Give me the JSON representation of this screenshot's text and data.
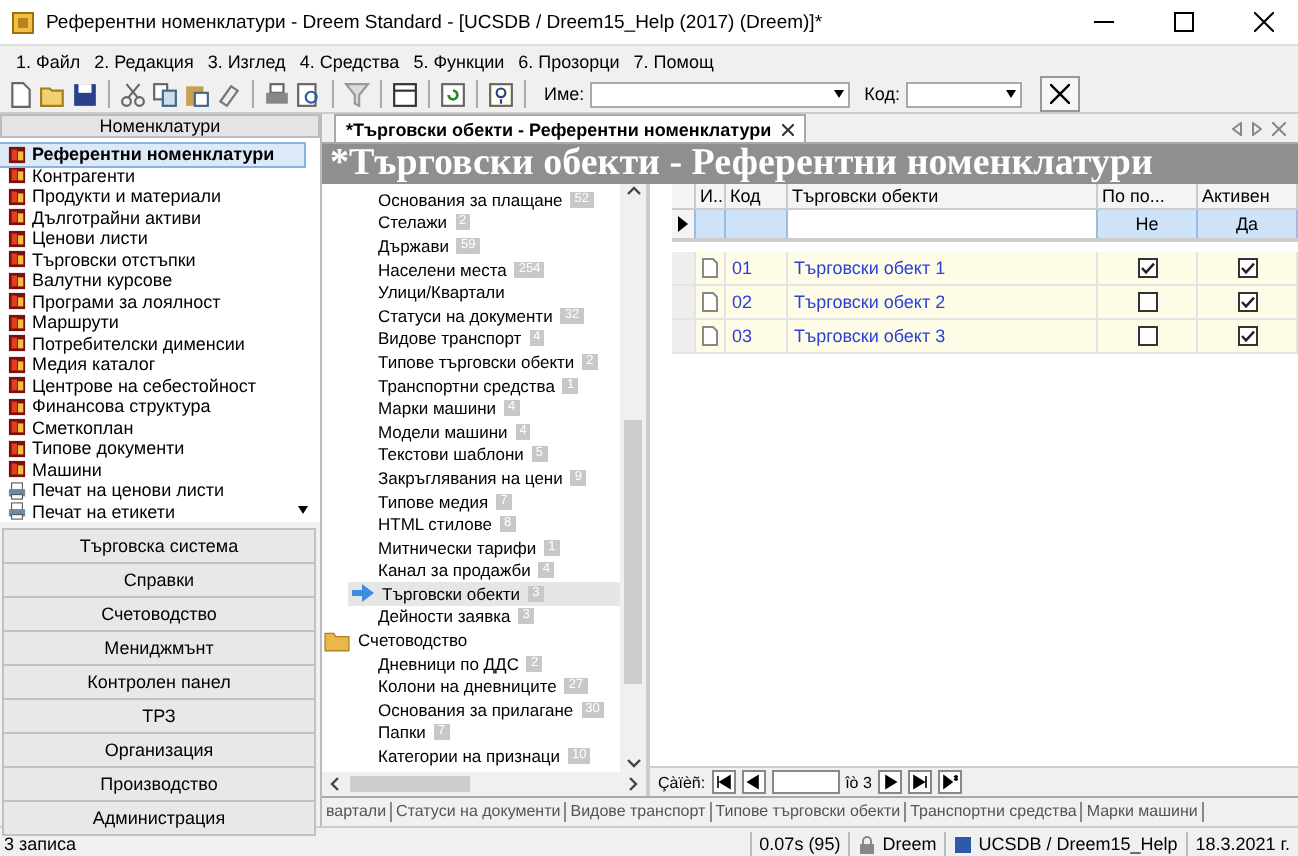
{
  "window": {
    "title": "Референтни номенклатури - Dreem Standard - [UCSDB / Dreem15_Help (2017) (Dreem)]*"
  },
  "menu": [
    "1. Файл",
    "2. Редакция",
    "3. Изглед",
    "4. Средства",
    "5. Функции",
    "6. Прозорци",
    "7. Помощ"
  ],
  "toolbar": {
    "name_label": "Име:",
    "code_label": "Код:"
  },
  "sidebar": {
    "header": "Номенклатури",
    "items": [
      {
        "label": "Референтни номенклатури",
        "kind": "module",
        "selected": true
      },
      {
        "label": "Контрагенти",
        "kind": "module",
        "selected": false
      },
      {
        "label": "Продукти и материали",
        "kind": "module",
        "selected": false
      },
      {
        "label": "Дълготрайни активи",
        "kind": "module",
        "selected": false
      },
      {
        "label": "Ценови листи",
        "kind": "module",
        "selected": false
      },
      {
        "label": "Търговски отстъпки",
        "kind": "module",
        "selected": false
      },
      {
        "label": "Валутни курсове",
        "kind": "module",
        "selected": false
      },
      {
        "label": "Програми за лоялност",
        "kind": "module",
        "selected": false
      },
      {
        "label": "Маршрути",
        "kind": "module",
        "selected": false
      },
      {
        "label": "Потребителски дименсии",
        "kind": "module",
        "selected": false
      },
      {
        "label": "Медия каталог",
        "kind": "module",
        "selected": false
      },
      {
        "label": "Центрове на себестойност",
        "kind": "module",
        "selected": false
      },
      {
        "label": "Финансова структура",
        "kind": "module",
        "selected": false
      },
      {
        "label": "Сметкоплан",
        "kind": "module",
        "selected": false
      },
      {
        "label": "Типове документи",
        "kind": "module",
        "selected": false
      },
      {
        "label": "Машини",
        "kind": "module",
        "selected": false
      },
      {
        "label": "Печат на ценови листи",
        "kind": "print",
        "selected": false
      },
      {
        "label": "Печат на етикети",
        "kind": "print",
        "selected": false
      }
    ],
    "groups": [
      "Търговска система",
      "Справки",
      "Счетоводство",
      "Мениджмънт",
      "Контролен панел",
      "ТРЗ",
      "Организация",
      "Производство",
      "Администрация"
    ]
  },
  "tabs": [
    {
      "label": "*Търговски обекти - Референтни номенклатури",
      "selected": true
    }
  ],
  "page_title": "*Търговски обекти - Референтни номенклатури",
  "tree": [
    {
      "label": "Основания за плащане",
      "count": "52",
      "kind": "item",
      "selected": false
    },
    {
      "label": "Стелажи",
      "count": "2",
      "kind": "item",
      "selected": false
    },
    {
      "label": "Държави",
      "count": "59",
      "kind": "item",
      "selected": false
    },
    {
      "label": "Населени места",
      "count": "254",
      "kind": "item",
      "selected": false
    },
    {
      "label": "Улици/Квартали",
      "kind": "item",
      "selected": false
    },
    {
      "label": "Статуси на документи",
      "count": "32",
      "kind": "item",
      "selected": false
    },
    {
      "label": "Видове транспорт",
      "count": "4",
      "kind": "item",
      "selected": false
    },
    {
      "label": "Типове търговски обекти",
      "count": "2",
      "kind": "item",
      "selected": false
    },
    {
      "label": "Транспортни средства",
      "count": "1",
      "kind": "item",
      "selected": false
    },
    {
      "label": "Марки машини",
      "count": "4",
      "kind": "item",
      "selected": false
    },
    {
      "label": "Модели машини",
      "count": "4",
      "kind": "item",
      "selected": false
    },
    {
      "label": "Текстови шаблони",
      "count": "5",
      "kind": "item",
      "selected": false
    },
    {
      "label": "Закръглявания на цени",
      "count": "9",
      "kind": "item",
      "selected": false
    },
    {
      "label": "Типове медия",
      "count": "7",
      "kind": "item",
      "selected": false
    },
    {
      "label": "HTML стилове",
      "count": "8",
      "kind": "item",
      "selected": false
    },
    {
      "label": "Митнически тарифи",
      "count": "1",
      "kind": "item",
      "selected": false
    },
    {
      "label": "Канал за продажби",
      "count": "4",
      "kind": "item",
      "selected": false
    },
    {
      "label": "Търговски обекти",
      "count": "3",
      "kind": "item",
      "selected": true
    },
    {
      "label": "Дейности заявка",
      "count": "3",
      "kind": "item",
      "selected": false
    },
    {
      "label": "Счетоводство",
      "kind": "folder",
      "selected": false,
      "children": [
        {
          "label": "Дневници по ДДС",
          "count": "2",
          "kind": "item",
          "selected": false
        },
        {
          "label": "Колони на дневниците",
          "count": "27",
          "kind": "item",
          "selected": false
        },
        {
          "label": "Основания за прилагане",
          "count": "30",
          "kind": "item",
          "selected": false
        },
        {
          "label": "Папки",
          "count": "7",
          "kind": "item",
          "selected": false
        },
        {
          "label": "Категории на признаци",
          "count": "10",
          "kind": "item",
          "selected": false
        }
      ]
    }
  ],
  "table": {
    "columns": [
      "И...",
      "Код",
      "Търговски обекти",
      "По по...",
      "Активен"
    ],
    "filter": {
      "column_4": "Не",
      "column_5": "Да"
    },
    "rows": [
      {
        "code": "01",
        "name": "Търговски обект 1",
        "column_4": true,
        "active": true
      },
      {
        "code": "02",
        "name": "Търговски обект 2",
        "column_4": false,
        "active": true
      },
      {
        "code": "03",
        "name": "Търговски обект 3",
        "column_4": false,
        "active": true
      }
    ]
  },
  "navigator": {
    "label": "Çàïèñ:",
    "of": "îò 3"
  },
  "bottom_tabs": [
    "вартали",
    "Статуси на документи",
    "Видове транспорт",
    "Типове търговски обекти",
    "Транспортни средства",
    "Марки машини"
  ],
  "status_bar": {
    "records": "3 записа",
    "timing": "0.07s (95)",
    "user": "Dreem",
    "database": "UCSDB / Dreem15_Help",
    "date": "18.3.2021 г."
  }
}
